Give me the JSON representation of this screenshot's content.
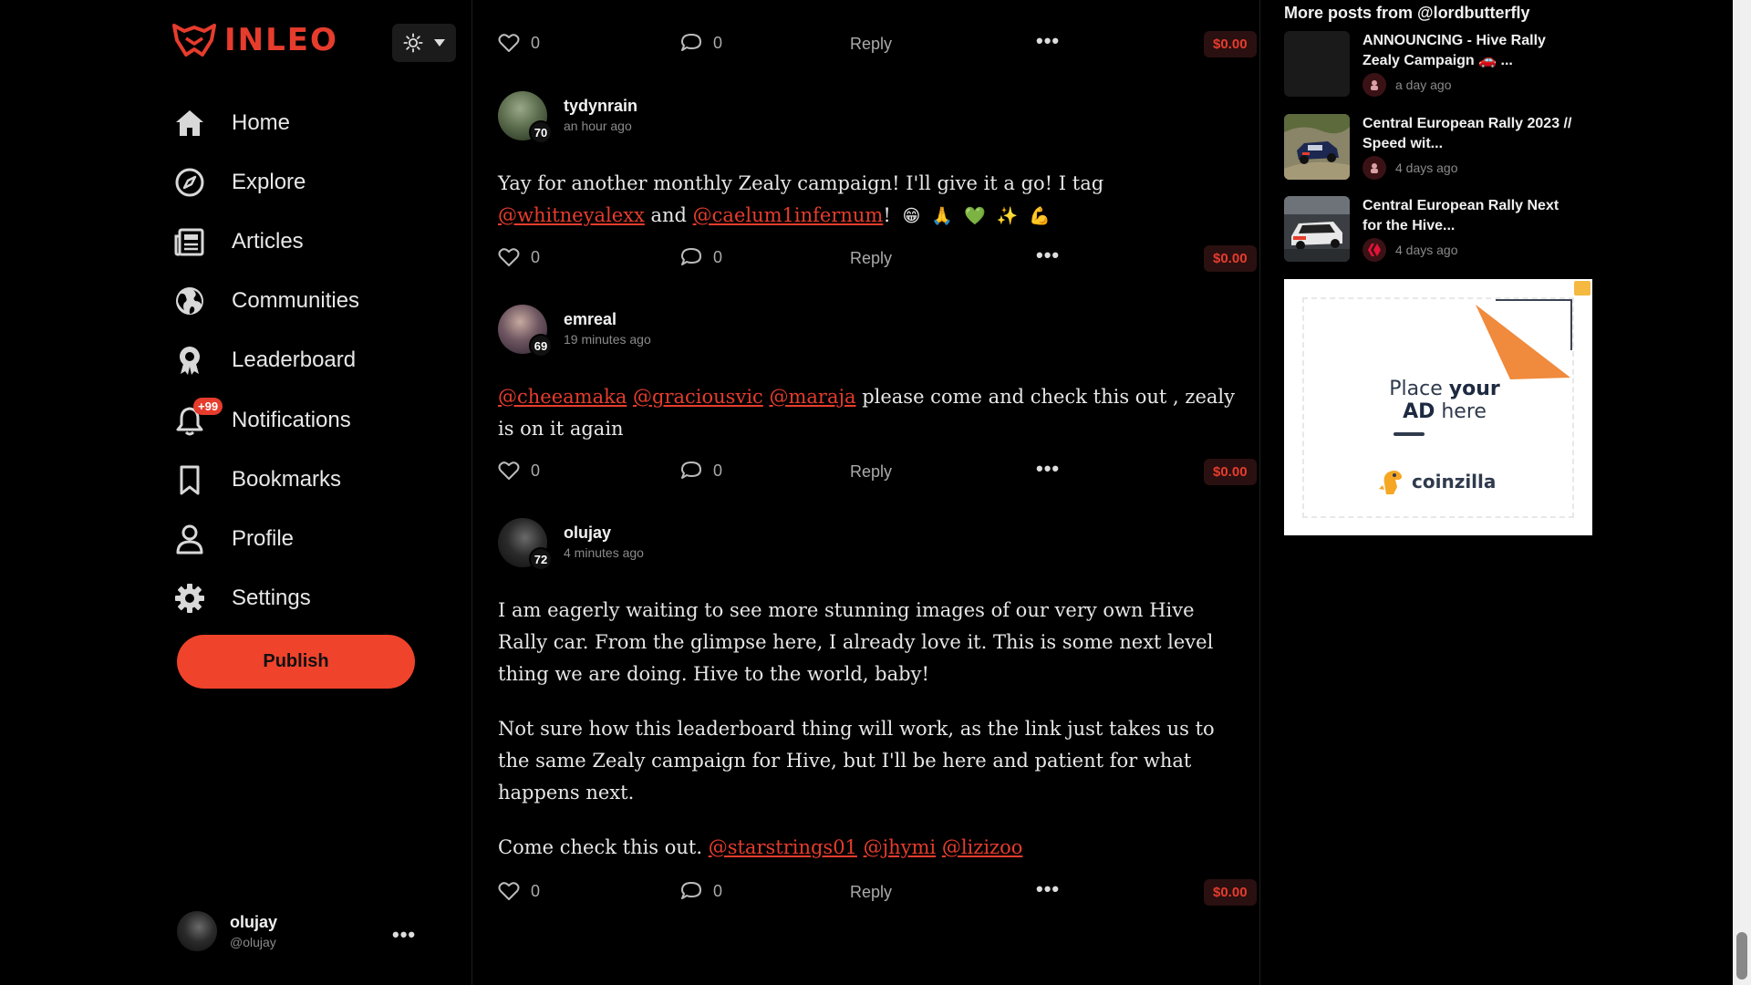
{
  "brand": {
    "logo_text": "INLEO",
    "accent": "#e63c2d"
  },
  "sidebar": {
    "items": [
      {
        "label": "Home",
        "icon": "home-icon"
      },
      {
        "label": "Explore",
        "icon": "compass-icon"
      },
      {
        "label": "Articles",
        "icon": "newspaper-icon"
      },
      {
        "label": "Communities",
        "icon": "globe-icon"
      },
      {
        "label": "Leaderboard",
        "icon": "award-icon"
      },
      {
        "label": "Notifications",
        "icon": "bell-icon",
        "badge": "+99"
      },
      {
        "label": "Bookmarks",
        "icon": "bookmark-icon"
      },
      {
        "label": "Profile",
        "icon": "user-icon"
      },
      {
        "label": "Settings",
        "icon": "gear-icon"
      }
    ],
    "publish_label": "Publish",
    "account": {
      "name": "olujay",
      "handle": "@olujay"
    }
  },
  "feed": {
    "top_actions": {
      "likes": "0",
      "comments": "0",
      "reply": "Reply",
      "payout": "$0.00"
    },
    "comments": [
      {
        "author": "tydynrain",
        "reputation": "70",
        "time": "an hour ago",
        "p1_text": "Yay for another monthly Zealy campaign! I'll give it a go! I tag ",
        "m1": "@whitneyalexx",
        "p1_and": " and ",
        "m2": "@caelum1infernum",
        "p1_end": "!",
        "emojis": [
          "😁",
          "🙏",
          "💚",
          "✨",
          "💪"
        ],
        "likes": "0",
        "comment_count": "0",
        "reply": "Reply",
        "payout": "$0.00"
      },
      {
        "author": "emreal",
        "reputation": "69",
        "time": "19 minutes ago",
        "m1": "@cheeamaka",
        "m2": "@graciousvic",
        "m3": "@maraja",
        "text": " please come and check this out , zealy is on it again",
        "likes": "0",
        "comment_count": "0",
        "reply": "Reply",
        "payout": "$0.00"
      },
      {
        "author": "olujay",
        "reputation": "72",
        "time": "4 minutes ago",
        "p1": "I am eagerly waiting to see more stunning images of our very own Hive Rally car. From the glimpse here, I already love it. This is some next level thing we are doing. Hive to the world, baby!",
        "p2": "Not sure how this leaderboard thing will work, as the link just takes us to the same Zealy campaign for Hive, but I'll be here and patient for what happens next.",
        "p3_text": "Come check this out. ",
        "m1": "@starstrings01",
        "m2": "@jhymi",
        "m3": "@lizizoo",
        "likes": "0",
        "comment_count": "0",
        "reply": "Reply",
        "payout": "$0.00"
      }
    ]
  },
  "right": {
    "title": "More posts from @lordbutterfly",
    "posts": [
      {
        "title": "ANNOUNCING - Hive Rally Zealy Campaign 🚗 ...",
        "time": "a day ago"
      },
      {
        "title": "Central European Rally 2023 // Speed wit...",
        "time": "4 days ago"
      },
      {
        "title": "Central European Rally Next for the Hive...",
        "time": "4 days ago"
      }
    ],
    "ad": {
      "line1_a": "Place ",
      "line1_b": "your",
      "line2_a": "AD",
      "line2_b": " here",
      "brand": "coinzilla"
    }
  }
}
